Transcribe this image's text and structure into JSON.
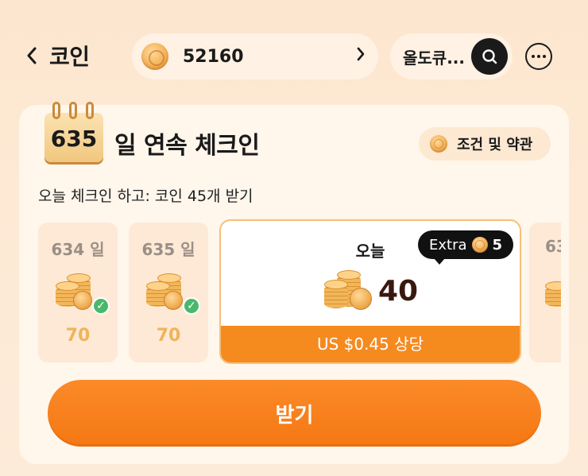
{
  "header": {
    "back_icon": "chevron-left-icon",
    "title": "코인",
    "coin_balance": "52160",
    "search_query": "올도큐...",
    "search_icon": "search-icon",
    "more_icon": "more-horizontal-icon"
  },
  "checkin": {
    "streak_days": "635",
    "streak_title": "일 연속 체크인",
    "terms_label": "조건 및 약관",
    "subtitle": "오늘 체크인 하고: 코인 45개 받기",
    "days": [
      {
        "label": "634 일",
        "value": "70",
        "checked": true
      },
      {
        "label": "635 일",
        "value": "70",
        "checked": true
      }
    ],
    "today": {
      "label": "오늘",
      "value": "40",
      "extra_label": "Extra",
      "extra_value": "5",
      "usd_text": "US $0.45 상당"
    },
    "next_partial_label": "63"
  },
  "claim_button": "받기",
  "colors": {
    "accent": "#f58a1f",
    "check": "#49b86b",
    "coin": "#f4b35a"
  }
}
